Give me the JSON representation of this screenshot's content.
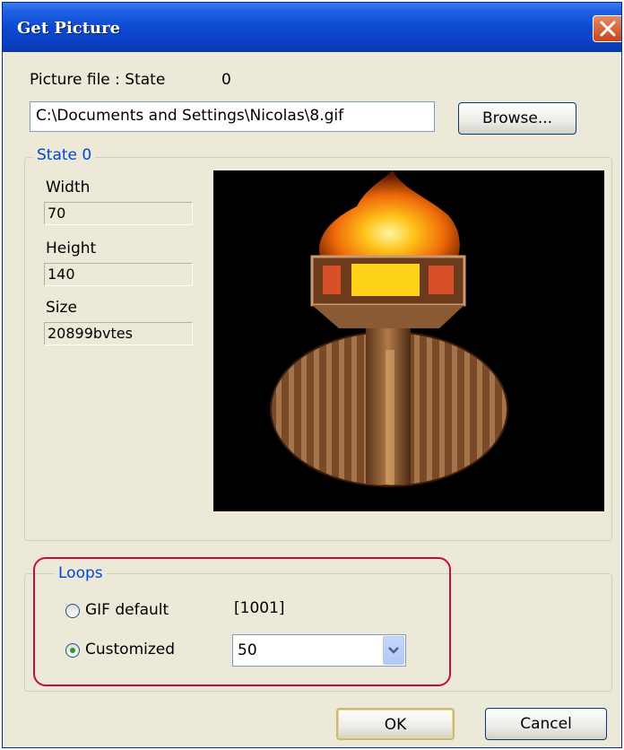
{
  "window": {
    "title": "Get Picture"
  },
  "picture_file": {
    "label": "Picture file : State",
    "state_number": "0",
    "path_value": "C:\\Documents and Settings\\Nicolas\\8.gif",
    "browse_label": "Browse..."
  },
  "state_group": {
    "legend": "State 0",
    "width_label": "Width",
    "width_value": "70",
    "height_label": "Height",
    "height_value": "140",
    "size_label": "Size",
    "size_value": "20899bvtes"
  },
  "loops": {
    "legend": "Loops",
    "gif_default_label": "GIF default",
    "gif_default_value": "[1001]",
    "customized_label": "Customized",
    "customized_value": "50",
    "selected": "customized"
  },
  "buttons": {
    "ok_label": "OK",
    "cancel_label": "Cancel"
  },
  "colors": {
    "annotation": "#c8102e",
    "legend_blue": "#0046d5"
  }
}
